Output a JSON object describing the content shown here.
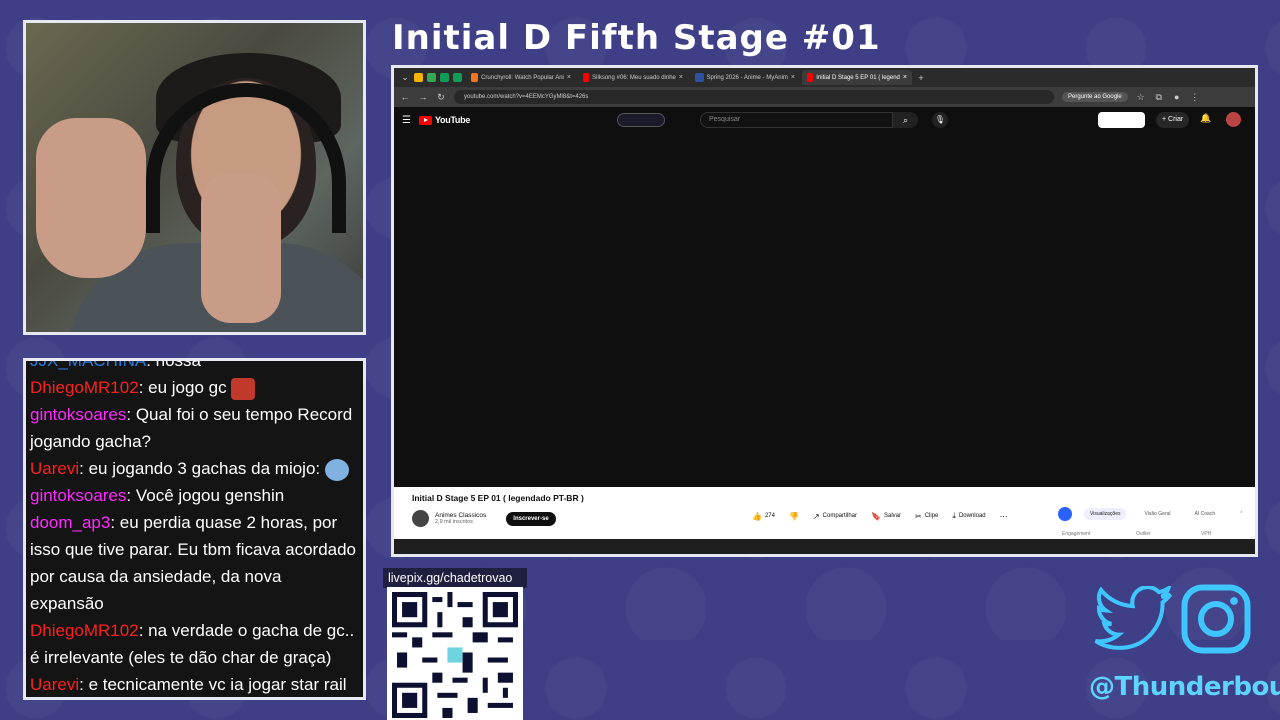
{
  "stream": {
    "title": "Initial D Fifth Stage #01",
    "qr_label": "livepix.gg/chadetrovao",
    "social_handle": "@Thunderbout"
  },
  "chat": {
    "messages": [
      {
        "user": "JJX_MACHINA",
        "text": ": nossa",
        "color": "#2d7be0"
      },
      {
        "user": "DhiegoMR102",
        "text": ": eu jogo gc ",
        "color": "#ff2020",
        "emote": "red"
      },
      {
        "user": "gintoksoares",
        "text": ": Qual foi o seu tempo Record jogando gacha?",
        "color": "#ff2bff"
      },
      {
        "user": "Uarevi",
        "text": ": eu jogando 3 gachas da miojo: ",
        "color": "#ff2020",
        "emote": "blue"
      },
      {
        "user": "gintoksoares",
        "text": ": Você jogou genshin",
        "color": "#ff2bff"
      },
      {
        "user": "doom_ap3",
        "text": ": eu perdia quase 2 horas, por isso que tive parar. Eu tbm ficava acordado por causa da ansiedade, da nova expansão",
        "color": "#ff2bff"
      },
      {
        "user": "DhiegoMR102",
        "text": ": na verdade o gacha de gc.. é irrelevante (eles te dão char de graça)",
        "color": "#ff2020"
      },
      {
        "user": "Uarevi",
        "text": ": e tecnicamente vc ia jogar star rail se ele cair na rodinha",
        "color": "#ff2020"
      }
    ]
  },
  "browser": {
    "tabs": [
      {
        "label": "Crunchyroll: Watch Popular Ani",
        "active": false
      },
      {
        "label": "Silksong #06: Meu suado dinhe",
        "active": false
      },
      {
        "label": "Spring 2026 - Anime - MyAnim",
        "active": false
      },
      {
        "label": "Initial D Stage 5 EP 01 ( legend",
        "active": true
      }
    ],
    "url": "youtube.com/watch?v=4EEMcYGyMl8&t=426s",
    "gemini_label": "Pergunte ao Google"
  },
  "youtube": {
    "logo": "YouTube",
    "search_placeholder": "Pesquisar",
    "create_label": "Criar",
    "video_title": "Initial D Stage 5 EP 01 ( legendado PT-BR )",
    "channel_name": "Animes Classicos",
    "channel_subs": "2,9 mil inscritos",
    "subscribe_label": "Inscrever-se",
    "likes": "274",
    "share_label": "Compartilhar",
    "save_label": "Salvar",
    "clip_label": "Clipe",
    "download_label": "Download",
    "ext_tabs": [
      "Visualizações",
      "Visão Geral",
      "AI Coach"
    ],
    "ext_subs": [
      "Engagement",
      "Outlier",
      "VPH"
    ]
  },
  "colors": {
    "background": "#3e3f86",
    "handle": "#5ed5ff"
  }
}
